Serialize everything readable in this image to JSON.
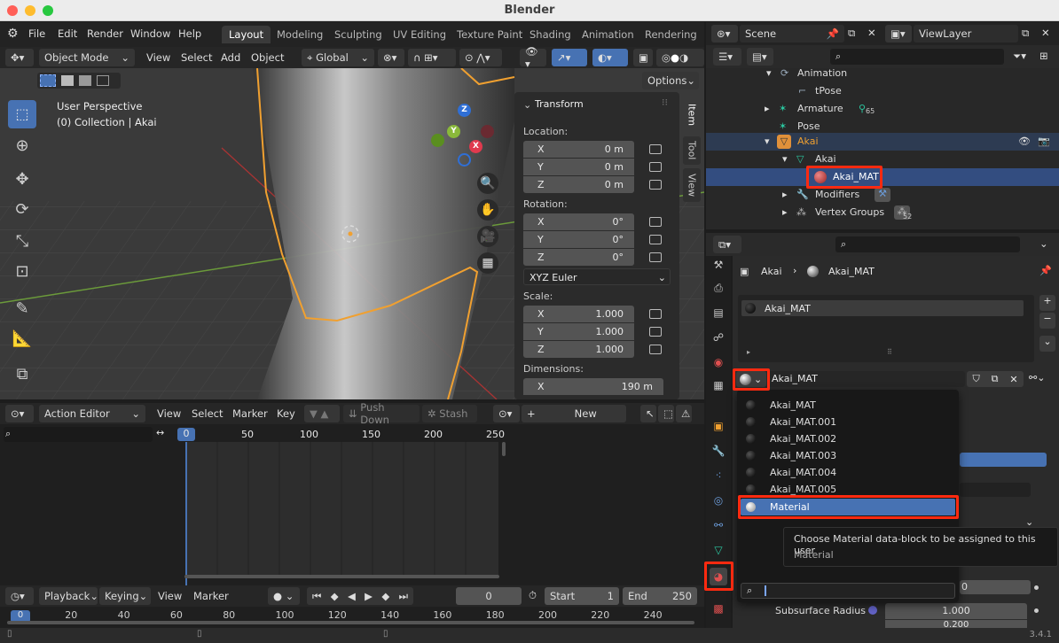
{
  "window": {
    "title": "Blender"
  },
  "menubar": {
    "file": "File",
    "edit": "Edit",
    "render": "Render",
    "window": "Window",
    "help": "Help"
  },
  "workspaces": [
    "Layout",
    "Modeling",
    "Sculpting",
    "UV Editing",
    "Texture Paint",
    "Shading",
    "Animation",
    "Rendering"
  ],
  "scene": {
    "name": "Scene",
    "view_layer": "ViewLayer"
  },
  "viewport_header": {
    "mode": "Object Mode",
    "view": "View",
    "select": "Select",
    "add": "Add",
    "object": "Object",
    "orientation": "Global",
    "options": "Options"
  },
  "viewport": {
    "perspective": "User Perspective",
    "collection": "(0) Collection | Akai",
    "gizmo_z": "Z",
    "gizmo_y": "Y",
    "gizmo_x": "X"
  },
  "transform_panel": {
    "title": "Transform",
    "location_label": "Location:",
    "rotation_label": "Rotation:",
    "scale_label": "Scale:",
    "dimensions_label": "Dimensions:",
    "location": [
      {
        "axis": "X",
        "value": "0 m"
      },
      {
        "axis": "Y",
        "value": "0 m"
      },
      {
        "axis": "Z",
        "value": "0 m"
      }
    ],
    "rotation": [
      {
        "axis": "X",
        "value": "0°"
      },
      {
        "axis": "Y",
        "value": "0°"
      },
      {
        "axis": "Z",
        "value": "0°"
      }
    ],
    "rotation_mode": "XYZ Euler",
    "scale": [
      {
        "axis": "X",
        "value": "1.000"
      },
      {
        "axis": "Y",
        "value": "1.000"
      },
      {
        "axis": "Z",
        "value": "1.000"
      }
    ],
    "dimensions": [
      {
        "axis": "X",
        "value": "190 m"
      }
    ]
  },
  "side_tabs": [
    "Item",
    "Tool",
    "View"
  ],
  "action_editor": {
    "mode": "Action Editor",
    "view": "View",
    "select": "Select",
    "marker": "Marker",
    "key": "Key",
    "push_down": "Push Down",
    "stash": "Stash",
    "new": "New",
    "frame_ticks": [
      "0",
      "50",
      "100",
      "150",
      "200",
      "250"
    ]
  },
  "timeline": {
    "playback": "Playback",
    "keying": "Keying",
    "view": "View",
    "marker": "Marker",
    "current_frame": "0",
    "start_label": "Start",
    "start": "1",
    "end_label": "End",
    "end": "250",
    "ticks": [
      "0",
      "20",
      "40",
      "60",
      "80",
      "100",
      "120",
      "140",
      "160",
      "180",
      "200",
      "220",
      "240"
    ]
  },
  "outliner": {
    "rows": [
      {
        "label": "Animation",
        "indent": 2
      },
      {
        "label": "tPose",
        "indent": 3
      },
      {
        "label": "Armature",
        "indent": 2,
        "badge": "65"
      },
      {
        "label": "Pose",
        "indent": 2
      },
      {
        "label": "Akai",
        "indent": 1
      },
      {
        "label": "Akai",
        "indent": 2
      },
      {
        "label": "Akai_MAT",
        "indent": 3
      },
      {
        "label": "Modifiers",
        "indent": 2
      },
      {
        "label": "Vertex Groups",
        "indent": 2,
        "badge": "52"
      }
    ]
  },
  "properties": {
    "breadcrumb_object": "Akai",
    "breadcrumb_material": "Akai_MAT",
    "slot": "Akai_MAT",
    "material_field": "Akai_MAT",
    "subsurface_label": "Subsurface Radius",
    "subsurface_value": "1.000",
    "partial_value": "0.200",
    "partial_zero": "0"
  },
  "dropdown": {
    "items": [
      "Akai_MAT",
      "Akai_MAT.001",
      "Akai_MAT.002",
      "Akai_MAT.003",
      "Akai_MAT.004",
      "Akai_MAT.005",
      "Material"
    ],
    "search_placeholder": ""
  },
  "tooltip": {
    "text": "Choose Material data-block to be assigned to this user",
    "sub": "Material"
  },
  "status": {
    "version": "3.4.1"
  },
  "colors": {
    "accent": "#4772b3",
    "highlight": "#ff2a10",
    "selection": "#334d80"
  }
}
